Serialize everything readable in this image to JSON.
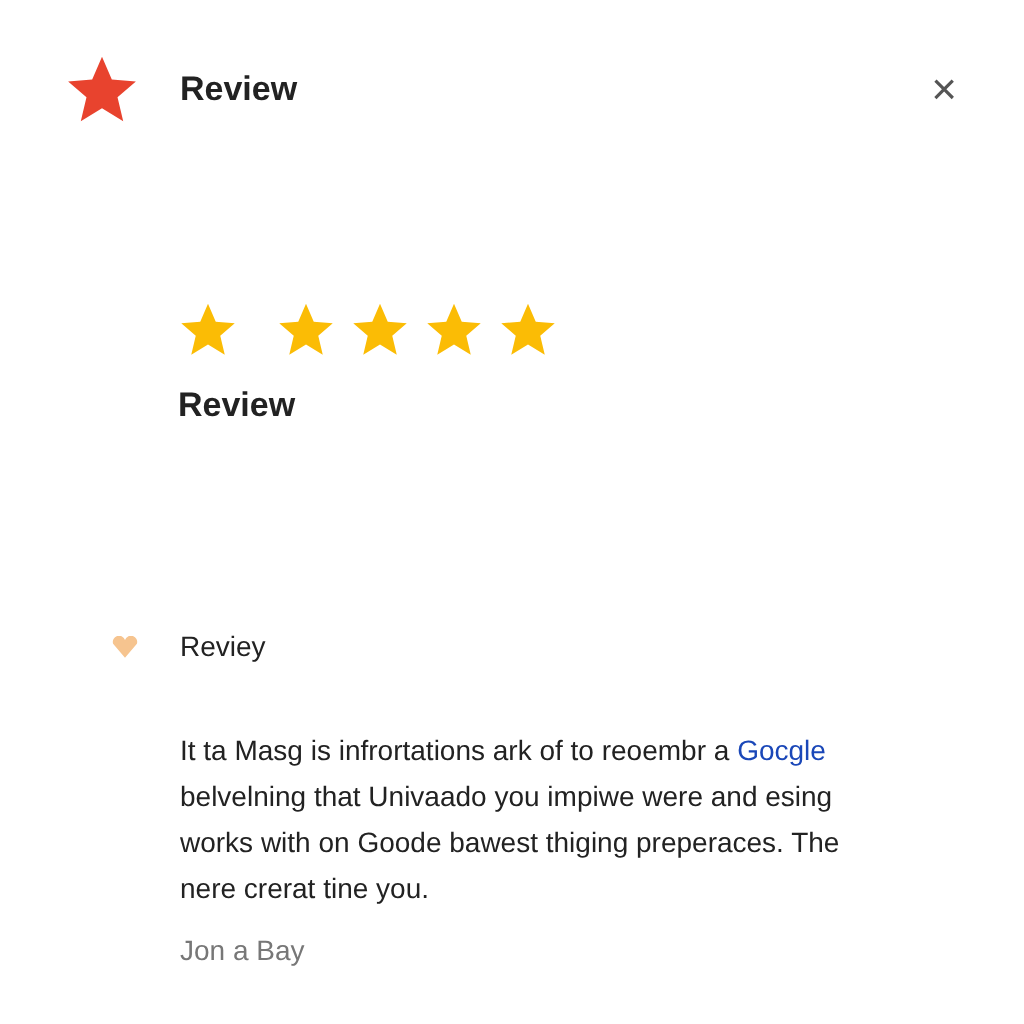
{
  "header": {
    "title": "Review",
    "close": "×"
  },
  "rating": {
    "stars": 5,
    "label": "Review"
  },
  "review": {
    "heading": "Reviey",
    "body": {
      "before": "It ta Masg is infrortations ark of to reoembr a ",
      "link": "Gocgle",
      "after": " belvelning that Univaado you impiwe were and esing works with on Goode bawest thiging preperaces. The nere crerat tine you."
    },
    "author": "Jon a Bay"
  }
}
